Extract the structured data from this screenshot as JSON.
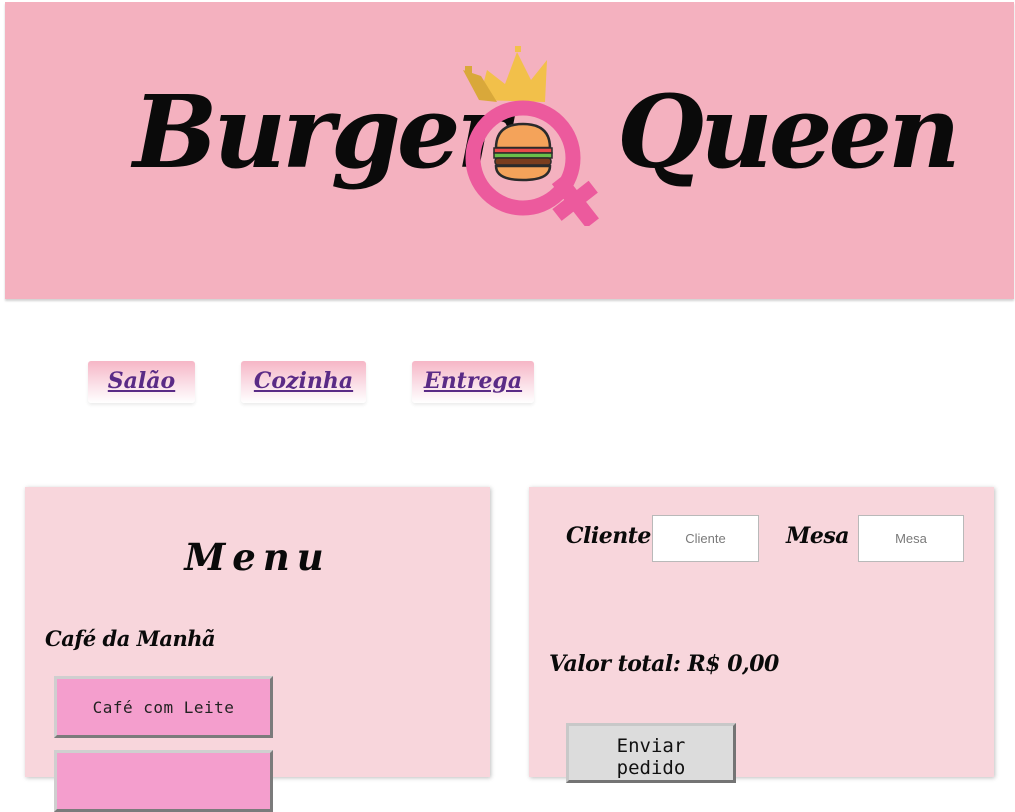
{
  "header": {
    "logo_left": "Burger",
    "logo_right": "Queen",
    "emblem_icon": "burger-venus-crown-icon"
  },
  "nav": {
    "tabs": [
      {
        "label": "Salão"
      },
      {
        "label": "Cozinha"
      },
      {
        "label": "Entrega"
      }
    ]
  },
  "menu": {
    "title": "Menu",
    "section_title": "Café da Manhã",
    "items": [
      {
        "label": "Café com Leite"
      },
      {
        "label": ""
      }
    ]
  },
  "order": {
    "client_label": "Cliente",
    "client_placeholder": "Cliente",
    "table_label": "Mesa",
    "table_placeholder": "Mesa",
    "total_label": "Valor total: R$ 0,00",
    "send_label": "Enviar\npedido"
  },
  "colors": {
    "banner": "#f4b1bf",
    "panel": "#f8d6dc",
    "menu_button": "#f49ecd",
    "nav_text": "#5a2b86",
    "emblem_pink": "#ec5a9d",
    "crown_gold": "#f2c04a"
  }
}
